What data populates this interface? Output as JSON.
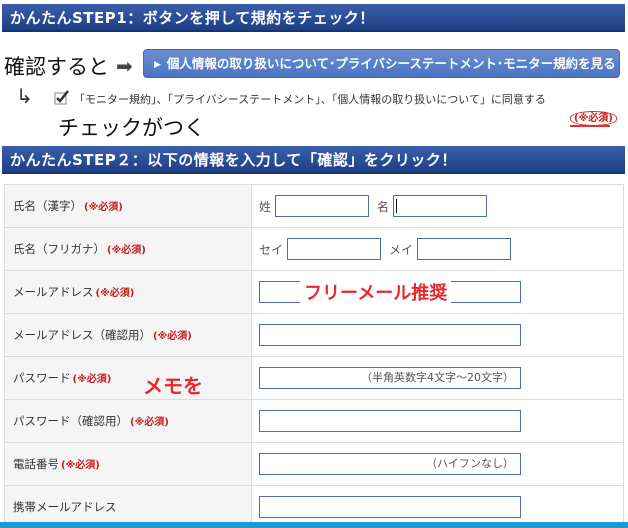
{
  "step1": {
    "title": "かんたんSTEP1：ボタンを押して規約をチェック！"
  },
  "annotations": {
    "confirm_note": "確認すると",
    "arrow": "➡",
    "check_note": "チェックがつく",
    "free_mail": "フリーメール推奨",
    "memo": "メモを"
  },
  "consent_button": {
    "label": "個人情報の取り扱いについて･プライバシーステートメント･モニター規約を見る"
  },
  "consent_check": {
    "text": "「モニター規約」、「プライバシーステートメント」、「個人情報の取り扱いについて」に同意する",
    "required": "(※必須)"
  },
  "step2": {
    "title": "かんたんSTEP２：以下の情報を入力して「確認」をクリック！"
  },
  "form": {
    "required_mark": "(※必須)",
    "rows": [
      {
        "label": "氏名（漢字）",
        "pre1": "姓",
        "pre2": "名"
      },
      {
        "label": "氏名（フリガナ）",
        "pre1": "セイ",
        "pre2": "メイ"
      },
      {
        "label": "メールアドレス"
      },
      {
        "label": "メールアドレス（確認用）"
      },
      {
        "label": "パスワード",
        "hint": "（半角英数字4文字～20文字）"
      },
      {
        "label": "パスワード（確認用）"
      },
      {
        "label": "電話番号",
        "hint": "（ハイフンなし）"
      },
      {
        "label": "携帯メールアドレス"
      }
    ]
  }
}
